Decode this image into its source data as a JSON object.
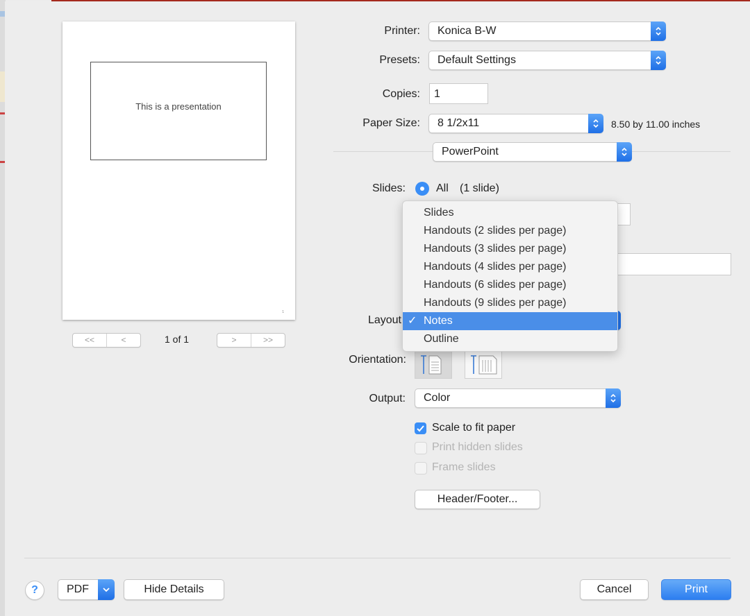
{
  "dialog": {
    "printer": {
      "label": "Printer:",
      "value": "Konica B-W"
    },
    "presets": {
      "label": "Presets:",
      "value": "Default Settings"
    },
    "copies": {
      "label": "Copies:",
      "value": "1"
    },
    "paper_size": {
      "label": "Paper Size:",
      "value": "8 1/2x11",
      "dimensions": "8.50 by 11.00 inches"
    },
    "section_popup": {
      "value": "PowerPoint"
    },
    "slides": {
      "label": "Slides:",
      "option_all": "All",
      "count": "(1 slide)"
    },
    "layout": {
      "label": "Layout",
      "menu_items": [
        {
          "label": "Slides",
          "selected": false
        },
        {
          "label": "Handouts (2 slides per page)",
          "selected": false
        },
        {
          "label": "Handouts (3 slides per page)",
          "selected": false
        },
        {
          "label": "Handouts (4 slides per page)",
          "selected": false
        },
        {
          "label": "Handouts (6 slides per page)",
          "selected": false
        },
        {
          "label": "Handouts (9 slides per page)",
          "selected": false
        },
        {
          "label": "Notes",
          "selected": true
        },
        {
          "label": "Outline",
          "selected": false
        }
      ],
      "checkmark": "✓"
    },
    "orientation": {
      "label": "Orientation:",
      "selected": "portrait"
    },
    "output": {
      "label": "Output:",
      "value": "Color"
    },
    "checkboxes": [
      {
        "label": "Scale to fit paper",
        "checked": true,
        "enabled": true
      },
      {
        "label": "Print hidden slides",
        "checked": false,
        "enabled": false
      },
      {
        "label": "Frame slides",
        "checked": false,
        "enabled": false
      }
    ],
    "header_footer_button": "Header/Footer..."
  },
  "preview": {
    "slide_text": "This is a presentation",
    "page_indicator": "1 of 1",
    "nav": {
      "first": "<<",
      "prev": "<",
      "next": ">",
      "last": ">>"
    }
  },
  "footer": {
    "help": "?",
    "pdf": "PDF",
    "hide_details": "Hide Details",
    "cancel": "Cancel",
    "print": "Print"
  },
  "colors": {
    "accent": "#3a8ef6",
    "menu_highlight": "#4a8ee8"
  }
}
